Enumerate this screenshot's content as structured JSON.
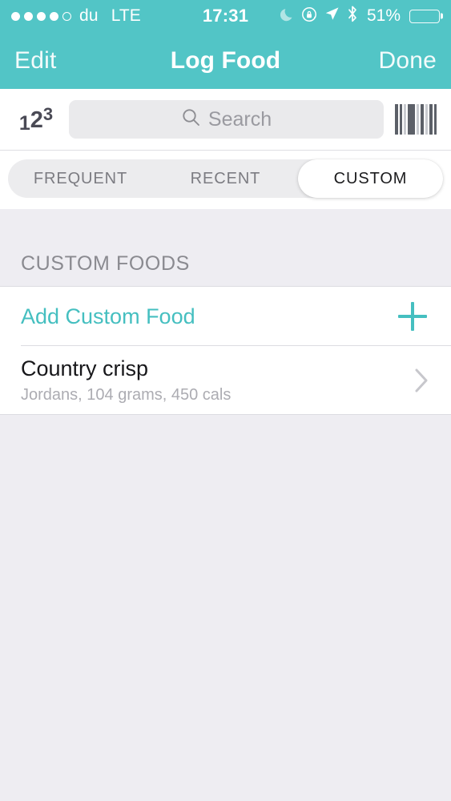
{
  "status_bar": {
    "signal_dots_filled": 4,
    "signal_dots_total": 5,
    "carrier": "du",
    "network": "LTE",
    "time": "17:31",
    "battery_percent": "51%",
    "battery_level": 51,
    "icons": [
      "moon-icon",
      "rotation-lock-icon",
      "location-arrow-icon",
      "bluetooth-icon"
    ]
  },
  "navbar": {
    "left_button": "Edit",
    "title": "Log Food",
    "right_button": "Done",
    "background_color": "#52C5C6"
  },
  "search": {
    "numpad_icon_digits": [
      "1",
      "2",
      "3"
    ],
    "placeholder": "Search",
    "value": "",
    "barcode_icon": "barcode-icon"
  },
  "tabs": {
    "items": [
      {
        "label": "FREQUENT",
        "active": false
      },
      {
        "label": "RECENT",
        "active": false
      },
      {
        "label": "CUSTOM",
        "active": true
      }
    ]
  },
  "section": {
    "header": "CUSTOM FOODS"
  },
  "list": {
    "add_row": {
      "label": "Add Custom Food",
      "accent_color": "#45BFC0",
      "icon": "plus-icon"
    },
    "items": [
      {
        "title": "Country crisp",
        "subtitle": "Jordans, 104 grams, 450 cals",
        "brand": "Jordans",
        "weight": "104 grams",
        "calories": "450 cals",
        "accessory": "chevron-right-icon"
      }
    ]
  },
  "colors": {
    "accent": "#45BFC0",
    "navbar": "#52C5C6",
    "background": "#EEEDF2",
    "card": "#FFFFFF",
    "separator": "#DCDCE1"
  }
}
